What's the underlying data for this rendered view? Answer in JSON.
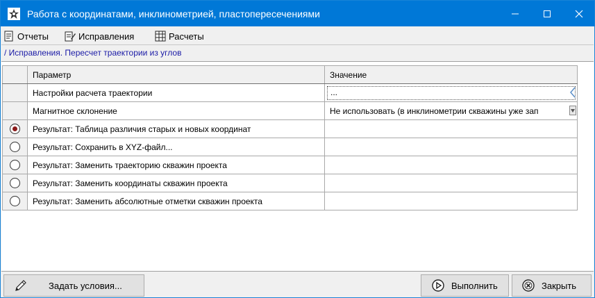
{
  "window": {
    "title": "Работа с координатами, инклинометрией, пластопересечениями",
    "title_icon": "app-logo-icon",
    "accent": "#0078d7"
  },
  "menu": {
    "items": [
      {
        "label": "Отчеты",
        "icon": "report-icon"
      },
      {
        "label": "Исправления",
        "icon": "edit-document-icon"
      },
      {
        "label": "Расчеты",
        "icon": "table-calc-icon"
      }
    ]
  },
  "breadcrumb": "/ Исправления. Пересчет траектории из углов",
  "grid": {
    "headers": {
      "param": "Параметр",
      "value": "Значение"
    },
    "rows": [
      {
        "param": "Настройки расчета траектории",
        "value": "...",
        "selector": "none"
      },
      {
        "param": "Магнитное склонение",
        "value": "Не использовать (в инклинометрии скважины уже зап",
        "selector": "none"
      },
      {
        "param": "Результат: Таблица различия старых и новых координат",
        "value": "",
        "selector": "radio",
        "checked": true
      },
      {
        "param": "Результат: Сохранить в XYZ-файл...",
        "value": "",
        "selector": "radio",
        "checked": false
      },
      {
        "param": "Результат: Заменить траекторию скважин проекта",
        "value": "",
        "selector": "radio",
        "checked": false
      },
      {
        "param": "Результат: Заменить координаты скважин проекта",
        "value": "",
        "selector": "radio",
        "checked": false
      },
      {
        "param": "Результат: Заменить абсолютные отметки скважин проекта",
        "value": "",
        "selector": "radio",
        "checked": false
      }
    ]
  },
  "buttons": {
    "conditions": "Задать условия...",
    "run": "Выполнить",
    "close": "Закрыть"
  }
}
